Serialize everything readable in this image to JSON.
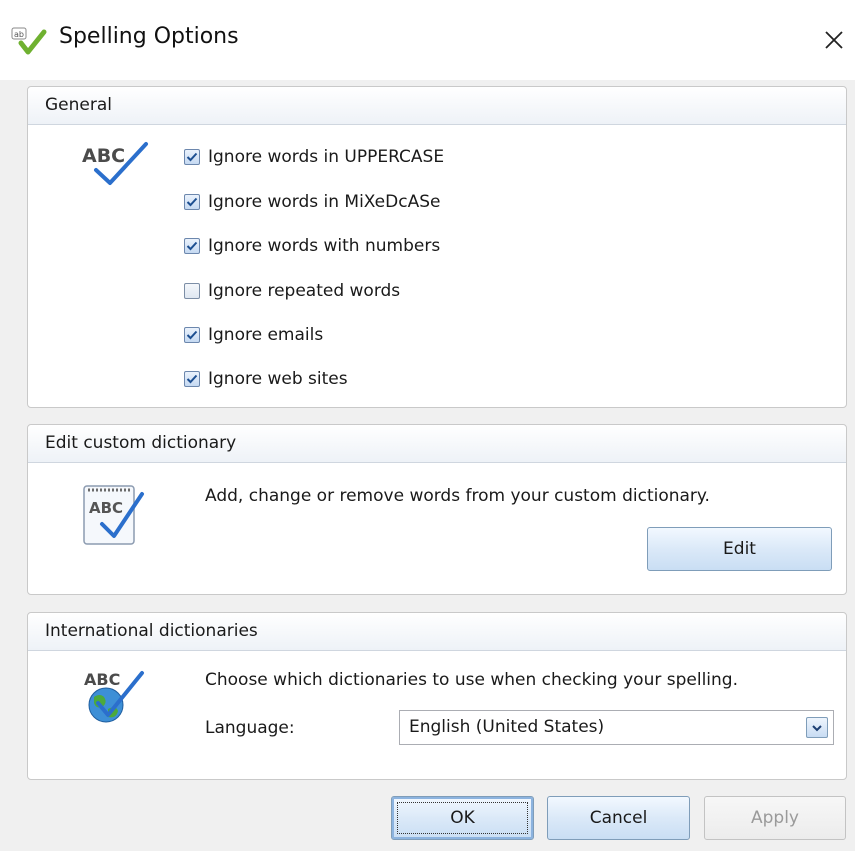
{
  "window": {
    "title": "Spelling Options",
    "title_icon": "spellcheck-icon",
    "close_icon": "close-icon"
  },
  "general": {
    "header": "General",
    "icon": "abc-check-icon",
    "options": [
      {
        "label": "Ignore words in UPPERCASE",
        "checked": true
      },
      {
        "label": "Ignore words in MiXeDcASe",
        "checked": true
      },
      {
        "label": "Ignore words with numbers",
        "checked": true
      },
      {
        "label": "Ignore repeated words",
        "checked": false
      },
      {
        "label": "Ignore emails",
        "checked": true
      },
      {
        "label": "Ignore web sites",
        "checked": true
      }
    ]
  },
  "custom_dictionary": {
    "header": "Edit custom dictionary",
    "icon": "dictionary-notepad-icon",
    "description": "Add, change or remove words from your custom dictionary.",
    "edit_label": "Edit"
  },
  "international": {
    "header": "International dictionaries",
    "icon": "globe-check-icon",
    "description": "Choose which dictionaries to use when checking your spelling.",
    "language_label": "Language:",
    "language_value": "English (United States)"
  },
  "footer": {
    "ok_label": "OK",
    "cancel_label": "Cancel",
    "apply_label": "Apply"
  },
  "icon_text": "ABC",
  "colors": {
    "check_blue": "#2b6fcc",
    "header_border": "#cfd6df"
  }
}
